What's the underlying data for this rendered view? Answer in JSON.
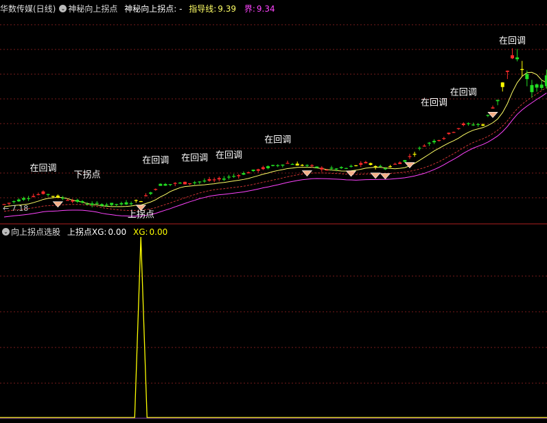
{
  "top_header": {
    "stock_name": "华数传媒(日线)",
    "indicator_name": "神秘向上拐点",
    "indicator_label": "神秘向上拐点: -",
    "guide_label": "指导线:",
    "guide_value": "9.39",
    "bound_label": "界:",
    "bound_value": "9.34"
  },
  "bottom_header": {
    "indicator_name": "向上拐点选股",
    "field1_label": "上拐点XG:",
    "field1_value": "0.00",
    "field2_label": "XG:",
    "field2_value": "0.00"
  },
  "colors": {
    "up": "#ff2a2a",
    "down": "#22dd22",
    "signal": "#ffff00",
    "guide_line": "#ffff66",
    "bound_line": "#ff44ff",
    "grid": "#7a1c1c",
    "diamond": "#f5b088"
  },
  "chart_data": [
    {
      "type": "candlestick",
      "price_range": [
        7.0,
        11.0
      ],
      "min_price_label": "7.18",
      "annotations": [
        {
          "text": "在回调",
          "index": 8,
          "price": 7.95
        },
        {
          "text": "下拐点",
          "index": 17,
          "price": 7.82
        },
        {
          "text": "上拐点",
          "index": 28,
          "price": 7.05
        },
        {
          "text": "在回调",
          "index": 31,
          "price": 8.1
        },
        {
          "text": "在回调",
          "index": 39,
          "price": 8.15
        },
        {
          "text": "在回调",
          "index": 46,
          "price": 8.2
        },
        {
          "text": "在回调",
          "index": 56,
          "price": 8.5
        },
        {
          "text": "在回调",
          "index": 88,
          "price": 9.22
        },
        {
          "text": "在回调",
          "index": 94,
          "price": 9.42
        },
        {
          "text": "在回调",
          "index": 104,
          "price": 10.42
        }
      ]
    },
    {
      "type": "line",
      "y_range": [
        0,
        1
      ],
      "series": [
        {
          "name": "XG",
          "spike_index": 27,
          "spike_value": 1
        }
      ]
    }
  ]
}
